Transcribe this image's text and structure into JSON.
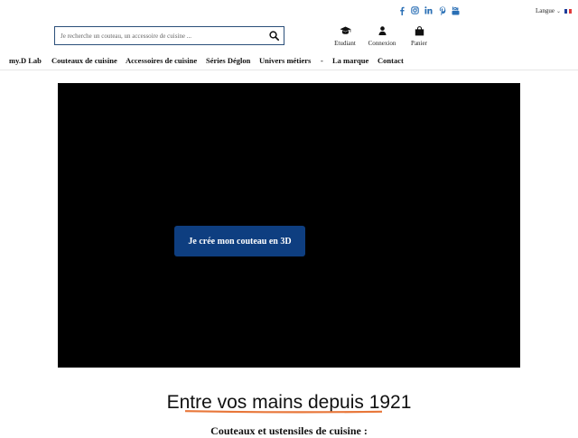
{
  "header": {
    "social_icons": [
      "facebook-icon",
      "instagram-icon",
      "linkedin-icon",
      "pinterest-icon",
      "youtube-icon"
    ],
    "language": {
      "label": "Langue",
      "flag": "fr"
    },
    "search": {
      "placeholder": "Je recherche un couteau, un accessoire de cuisine ..."
    },
    "account": [
      {
        "icon": "graduation-cap-icon",
        "label": "Etudiant"
      },
      {
        "icon": "user-icon",
        "label": "Connexion"
      },
      {
        "icon": "shopping-bag-icon",
        "label": "Panier"
      }
    ]
  },
  "nav": {
    "items": [
      "my.D Lab",
      "Couteaux de cuisine",
      "Accessoires de cuisine",
      "Séries Déglon",
      "Univers métiers",
      "-",
      "La marque",
      "Contact"
    ]
  },
  "hero": {
    "cta_label": "Je crée mon couteau en 3D"
  },
  "intro": {
    "headline": "Entre vos mains depuis 1921",
    "subheadline": "Couteaux et ustensiles de cuisine :"
  },
  "colors": {
    "brand_blue": "#0e3e80",
    "search_border": "#2b4f7a",
    "accent_underline": "#e8773a",
    "social_blue": "#2a6fb5"
  }
}
